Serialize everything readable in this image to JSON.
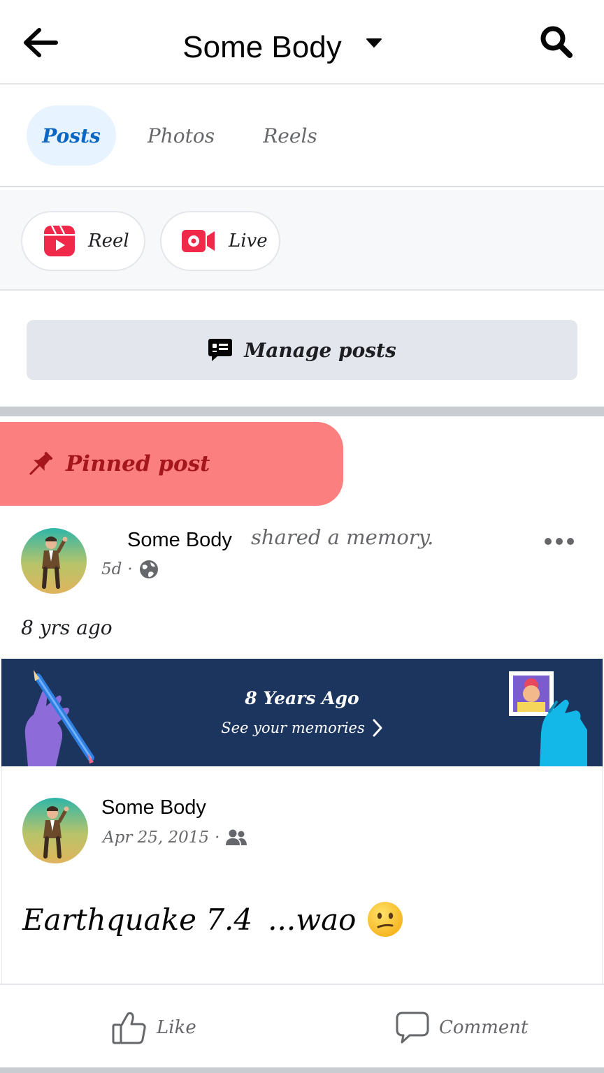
{
  "header": {
    "title": "Some Body",
    "back_icon": "arrow-left-icon",
    "dropdown_icon": "caret-down-icon",
    "search_icon": "search-icon"
  },
  "tabs": [
    {
      "label": "Posts",
      "active": true
    },
    {
      "label": "Photos",
      "active": false
    },
    {
      "label": "Reels",
      "active": false
    }
  ],
  "create": {
    "reel_label": "Reel",
    "live_label": "Live"
  },
  "manage": {
    "label": "Manage posts"
  },
  "pinned": {
    "label": "Pinned post",
    "color": "#fc7f7f"
  },
  "post": {
    "author": "Some Body",
    "action": "shared a memory.",
    "time": "5d",
    "separator": "·",
    "audience_icon": "globe-icon",
    "years_ago": "8 yrs ago"
  },
  "memory_banner": {
    "title": "8 Years Ago",
    "subtitle": "See your memories",
    "background": "#1c355e"
  },
  "shared_post": {
    "author": "Some Body",
    "date": "Apr 25, 2015",
    "separator": "·",
    "audience_icon": "friends-icon",
    "text_main": "Earthquake 7.4",
    "text_tail": "...wao",
    "emoji": "confused-face-emoji"
  },
  "actions": {
    "like_label": "Like",
    "comment_label": "Comment"
  }
}
